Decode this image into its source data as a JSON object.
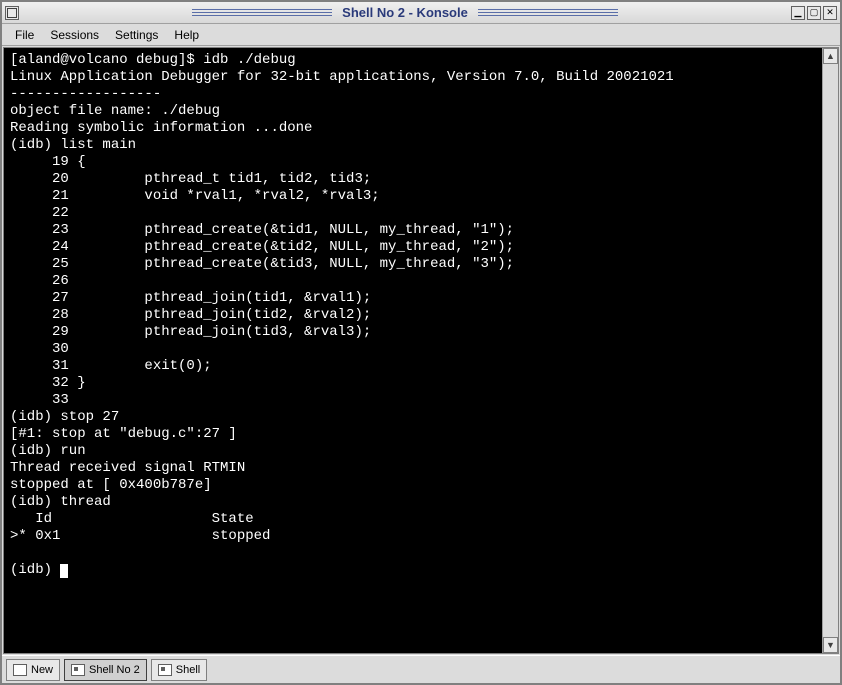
{
  "window": {
    "title": "Shell No 2 - Konsole"
  },
  "menubar": {
    "items": [
      "File",
      "Sessions",
      "Settings",
      "Help"
    ]
  },
  "terminal": {
    "lines": [
      "[aland@volcano debug]$ idb ./debug",
      "Linux Application Debugger for 32-bit applications, Version 7.0, Build 20021021",
      "------------------",
      "object file name: ./debug",
      "Reading symbolic information ...done",
      "(idb) list main",
      "     19 {",
      "     20         pthread_t tid1, tid2, tid3;",
      "     21         void *rval1, *rval2, *rval3;",
      "     22",
      "     23         pthread_create(&tid1, NULL, my_thread, \"1\");",
      "     24         pthread_create(&tid2, NULL, my_thread, \"2\");",
      "     25         pthread_create(&tid3, NULL, my_thread, \"3\");",
      "     26",
      "     27         pthread_join(tid1, &rval1);",
      "     28         pthread_join(tid2, &rval2);",
      "     29         pthread_join(tid3, &rval3);",
      "     30",
      "     31         exit(0);",
      "     32 }",
      "     33",
      "(idb) stop 27",
      "[#1: stop at \"debug.c\":27 ]",
      "(idb) run",
      "Thread received signal RTMIN",
      "stopped at [ 0x400b787e]",
      "(idb) thread",
      "   Id                   State",
      ">* 0x1                  stopped",
      "",
      "(idb) "
    ]
  },
  "statusbar": {
    "new_label": "New",
    "tabs": [
      {
        "label": "Shell No 2",
        "active": true
      },
      {
        "label": "Shell",
        "active": false
      }
    ]
  }
}
